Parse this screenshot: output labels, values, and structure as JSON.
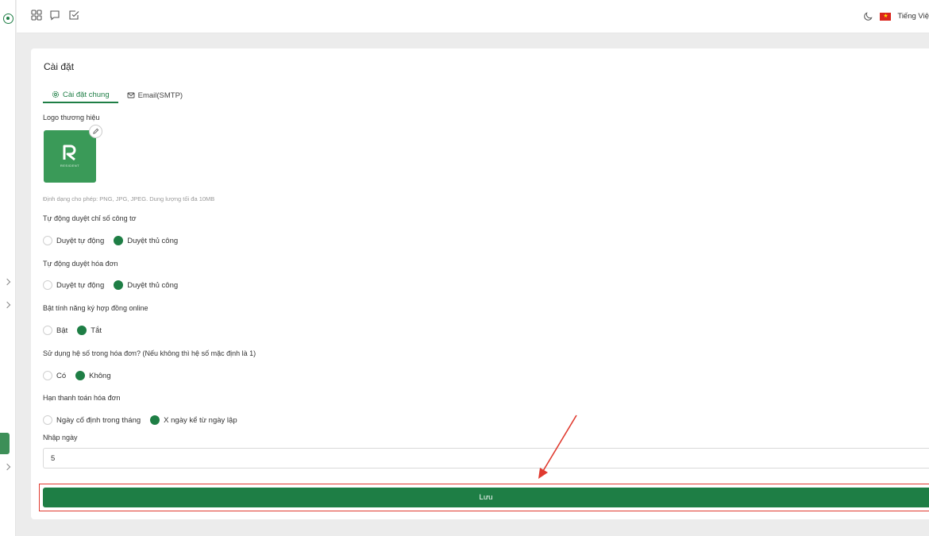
{
  "header": {
    "language_label": "Tiếng Việ"
  },
  "page": {
    "title": "Cài đặt"
  },
  "tabs": [
    {
      "label": "Cài đặt chung",
      "active": true
    },
    {
      "label": "Email(SMTP)",
      "active": false
    }
  ],
  "logo": {
    "label": "Logo thương hiệu",
    "brand_text": "RESIDENT",
    "hint": "Định dạng cho phép: PNG, JPG, JPEG. Dung lượng tối đa 10MB"
  },
  "settings": [
    {
      "label": "Tự động duyệt chỉ số công tơ",
      "options": [
        "Duyệt tự động",
        "Duyệt thủ công"
      ],
      "selected": 1
    },
    {
      "label": "Tự động duyệt hóa đơn",
      "options": [
        "Duyệt tự động",
        "Duyệt thủ công"
      ],
      "selected": 1
    },
    {
      "label": "Bật tính năng ký hợp đồng online",
      "options": [
        "Bật",
        "Tắt"
      ],
      "selected": 1
    },
    {
      "label": "Sử dụng hệ số trong hóa đơn? (Nếu không thì hệ số mặc định là 1)",
      "options": [
        "Có",
        "Không"
      ],
      "selected": 1
    },
    {
      "label": "Hạn thanh toán hóa đơn",
      "options": [
        "Ngày cố định trong tháng",
        "X ngày kể từ ngày lập"
      ],
      "selected": 1
    }
  ],
  "day_field": {
    "label": "Nhập ngày",
    "value": "5"
  },
  "save_label": "Lưu",
  "colors": {
    "primary": "#1e7e45",
    "annotation": "#e03a2f"
  }
}
